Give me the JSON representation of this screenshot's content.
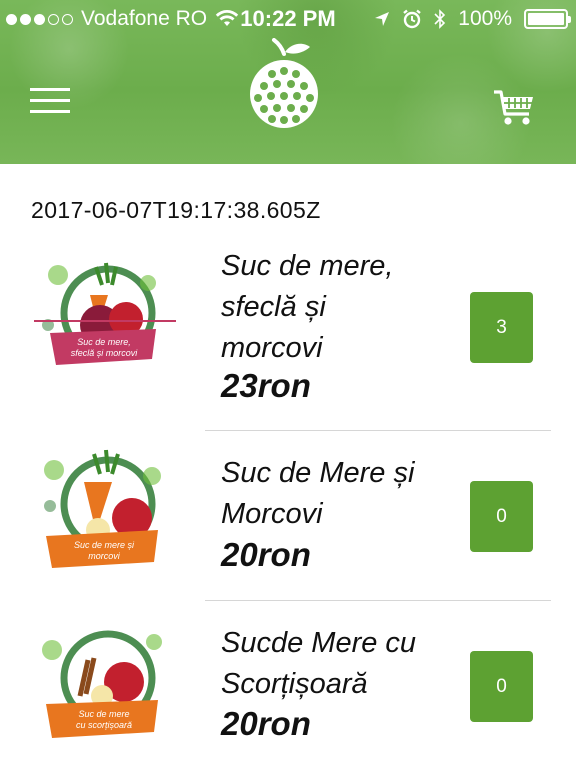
{
  "status_bar": {
    "carrier": "Vodafone RO",
    "time": "10:22 PM",
    "battery": "100%",
    "signal_bars_filled": 3,
    "signal_bars_total": 5
  },
  "header": {
    "menu_icon": "hamburger-menu-icon",
    "logo_icon": "apple-pattern-logo",
    "cart_icon": "shopping-cart-icon"
  },
  "timestamp": "2017-06-07T19:17:38.605Z",
  "products": [
    {
      "name": "Suc de mere,\nsfeclă și\nmorcovi",
      "price": "23ron",
      "quantity": "3",
      "label_line1": "Suc de mere,",
      "label_line2": "sfeclă și morcovi",
      "ribbon_color": "#c23a63"
    },
    {
      "name": "Suc de Mere și\nMorcovi",
      "price": "20ron",
      "quantity": "0",
      "label_line1": "Suc de mere și",
      "label_line2": "morcovi",
      "ribbon_color": "#e8761f"
    },
    {
      "name": "Sucde Mere cu\nScorțișoară",
      "price": "20ron",
      "quantity": "0",
      "label_line1": "Suc de mere",
      "label_line2": "cu scorțișoară",
      "ribbon_color": "#e8761f"
    }
  ],
  "colors": {
    "header_green": "#6cad4c",
    "button_green": "#5da132"
  }
}
